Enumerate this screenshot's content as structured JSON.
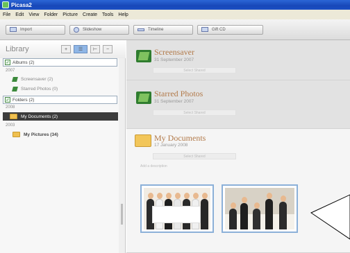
{
  "window": {
    "title": "Picasa2"
  },
  "menu": [
    "File",
    "Edit",
    "View",
    "Folder",
    "Picture",
    "Create",
    "Tools",
    "Help"
  ],
  "toolbar": {
    "import_label": "Import",
    "slideshow_label": "Slideshow",
    "timeline_label": "Timeline",
    "gift_label": "Gift CD"
  },
  "sidebar": {
    "title": "Library",
    "albums_group": "Albums (2)",
    "albums_year": "2007",
    "albums": [
      {
        "label": "Screensaver (2)"
      },
      {
        "label": "Starred Photos (0)"
      }
    ],
    "folders_group": "Folders (2)",
    "folders": [
      {
        "year": "2008",
        "label": "My Documents (2)"
      },
      {
        "year": "2003",
        "label": "My Pictures (34)"
      }
    ]
  },
  "main": {
    "albums": [
      {
        "title": "Screensaver",
        "date": "31 September 2007",
        "share": "Select Shared"
      },
      {
        "title": "Starred Photos",
        "date": "31 September 2007",
        "share": "Select Shared"
      }
    ],
    "folder": {
      "title": "My Documents",
      "date": "17 January 2008",
      "share": "Select Shared",
      "add_description": "Add a description"
    }
  },
  "colors": {
    "title_bar": "#1848b8",
    "album_title": "#b27a4a",
    "selected_row": "#3c3c3c",
    "thumb_border": "#8bb0d8"
  }
}
